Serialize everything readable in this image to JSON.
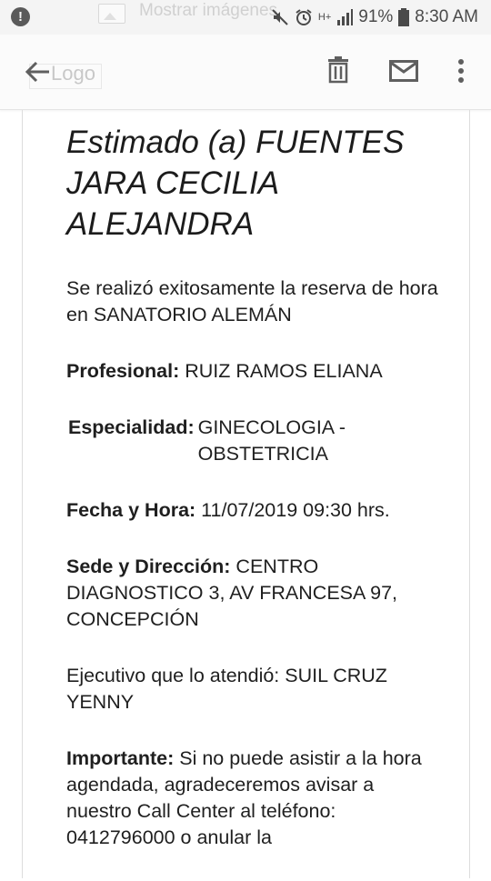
{
  "status_bar": {
    "notice_text": "Mostrar imágenes",
    "battery": "91%",
    "time": "8:30 AM",
    "network": "H+"
  },
  "toolbar": {
    "logo_alt": "Logo",
    "icons": [
      "back-arrow-icon",
      "trash-icon",
      "mail-icon",
      "more-vert-icon"
    ]
  },
  "email": {
    "greeting": "Estimado (a) FUENTES JARA CECILIA ALEJANDRA",
    "intro": "Se realizó exitosamente la reserva de hora en SANATORIO ALEMÁN",
    "profesional": {
      "label": "Profesional:",
      "value": "RUIZ RAMOS ELIANA"
    },
    "especialidad": {
      "label": "Especialidad:",
      "value": "GINECOLOGIA - OBSTETRICIA"
    },
    "fecha": {
      "label": "Fecha y Hora:",
      "value": "11/07/2019 09:30 hrs."
    },
    "sede": {
      "label": "Sede y Dirección:",
      "value": "CENTRO DIAGNOSTICO 3, AV FRANCESA 97, CONCEPCIÓN"
    },
    "ejecutivo": "Ejecutivo que lo atendió: SUIL CRUZ YENNY",
    "importante": {
      "label": "Importante:",
      "value": "Si no puede asistir a la hora agendada, agradeceremos avisar a nuestro Call Center al teléfono: 0412796000 o anular la"
    }
  }
}
